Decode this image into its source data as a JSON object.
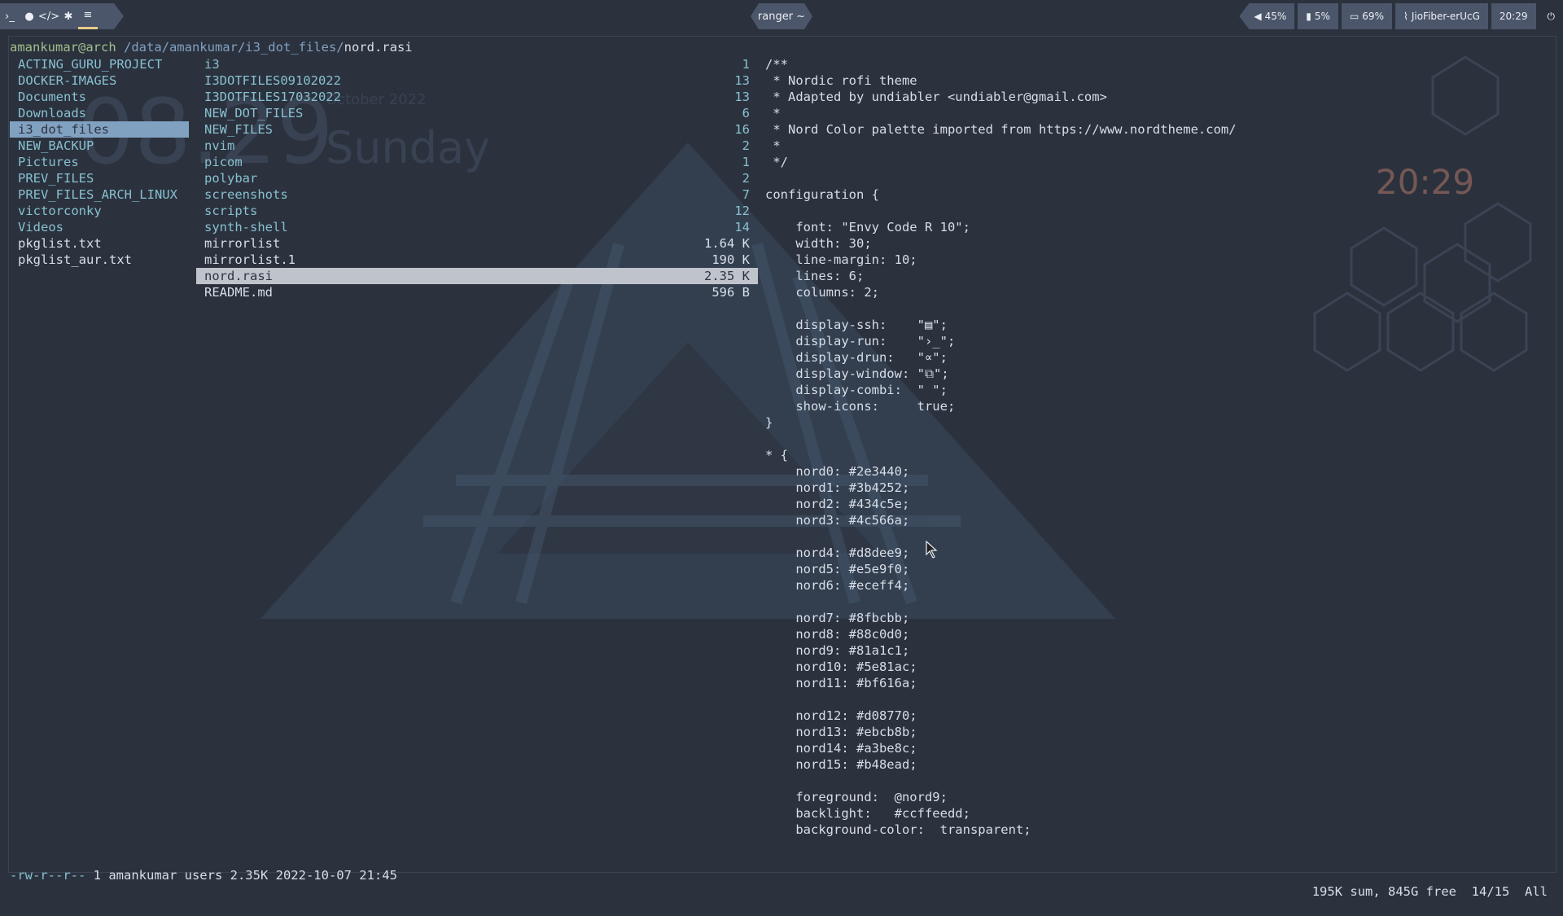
{
  "topbar": {
    "workspaces": [
      {
        "icon": "terminal-icon",
        "glyph": "›_"
      },
      {
        "icon": "firefox-icon",
        "glyph": "●"
      },
      {
        "icon": "code-icon",
        "glyph": "</>"
      },
      {
        "icon": "gear-icon",
        "glyph": "✱"
      },
      {
        "icon": "menu-icon",
        "glyph": "≡"
      }
    ],
    "window_title": "ranger ~",
    "volume": "45%",
    "brightness": "5%",
    "battery": "69%",
    "wifi": "JioFiber-erUcG",
    "time": "20:29"
  },
  "ranger": {
    "user_host": "amankumar@arch",
    "path_dir": " /data/amankumar/i3_dot_files/",
    "path_file": "nord.rasi",
    "parent_column": [
      {
        "name": "ACTING_GURU_PROJECT",
        "type": "dir"
      },
      {
        "name": "DOCKER-IMAGES",
        "type": "dir"
      },
      {
        "name": "Documents",
        "type": "dir"
      },
      {
        "name": "Downloads",
        "type": "dir"
      },
      {
        "name": "i3_dot_files",
        "type": "dir",
        "selected": true
      },
      {
        "name": "NEW_BACKUP",
        "type": "dir"
      },
      {
        "name": "Pictures",
        "type": "dir"
      },
      {
        "name": "PREV_FILES",
        "type": "dir"
      },
      {
        "name": "PREV_FILES_ARCH_LINUX",
        "type": "dir"
      },
      {
        "name": "victorconky",
        "type": "dir"
      },
      {
        "name": "Videos",
        "type": "dir"
      },
      {
        "name": "pkglist.txt",
        "type": "file"
      },
      {
        "name": "pkglist_aur.txt",
        "type": "file"
      }
    ],
    "current_column": [
      {
        "name": "i3",
        "size": "1",
        "type": "dir"
      },
      {
        "name": "I3DOTFILES09102022",
        "size": "13",
        "type": "dir"
      },
      {
        "name": "I3DOTFILES17032022",
        "size": "13",
        "type": "dir"
      },
      {
        "name": "NEW_DOT_FILES",
        "size": "6",
        "type": "dir"
      },
      {
        "name": "NEW_FILES",
        "size": "16",
        "type": "dir"
      },
      {
        "name": "nvim",
        "size": "2",
        "type": "dir"
      },
      {
        "name": "picom",
        "size": "1",
        "type": "dir"
      },
      {
        "name": "polybar",
        "size": "2",
        "type": "dir"
      },
      {
        "name": "screenshots",
        "size": "7",
        "type": "dir"
      },
      {
        "name": "scripts",
        "size": "12",
        "type": "dir"
      },
      {
        "name": "synth-shell",
        "size": "14",
        "type": "dir"
      },
      {
        "name": "mirrorlist",
        "size": "1.64 K",
        "type": "file"
      },
      {
        "name": "mirrorlist.1",
        "size": "190 K",
        "type": "file"
      },
      {
        "name": "nord.rasi",
        "size": "2.35 K",
        "type": "file",
        "selected": true
      },
      {
        "name": "README.md",
        "size": "596 B",
        "type": "file"
      }
    ],
    "preview_lines": [
      "/**",
      " * Nordic rofi theme",
      " * Adapted by undiabler <undiabler@gmail.com>",
      " *",
      " * Nord Color palette imported from https://www.nordtheme.com/",
      " *",
      " */",
      "",
      "configuration {",
      "",
      "    font: \"Envy Code R 10\";",
      "    width: 30;",
      "    line-margin: 10;",
      "    lines: 6;",
      "    columns: 2;",
      "",
      "    display-ssh:    \"▤\";",
      "    display-run:    \"›_\";",
      "    display-drun:   \"∝\";",
      "    display-window: \"⧉\";",
      "    display-combi:  \" \";",
      "    show-icons:     true;",
      "}",
      "",
      "* {",
      "    nord0: #2e3440;",
      "    nord1: #3b4252;",
      "    nord2: #434c5e;",
      "    nord3: #4c566a;",
      "",
      "    nord4: #d8dee9;",
      "    nord5: #e5e9f0;",
      "    nord6: #eceff4;",
      "",
      "    nord7: #8fbcbb;",
      "    nord8: #88c0d0;",
      "    nord9: #81a1c1;",
      "    nord10: #5e81ac;",
      "    nord11: #bf616a;",
      "",
      "    nord12: #d08770;",
      "    nord13: #ebcb8b;",
      "    nord14: #a3be8c;",
      "    nord15: #b48ead;",
      "",
      "    foreground:  @nord9;",
      "    backlight:   #ccffeedd;",
      "    background-color:  transparent;"
    ],
    "status": {
      "permissions": "-rw-r--r--",
      "info": " 1 amankumar users 2.35K 2022-10-07 21:45",
      "summary": "195K sum, 845G free  14/15  All"
    }
  },
  "desktop_widget": {
    "clock": "08.29",
    "day": "Sunday",
    "date": "October 2022",
    "conky_time": "20:29"
  },
  "colors": {
    "background": "#2b323e",
    "accent": "#81a1c1",
    "directory": "#88c0d0",
    "user": "#a3be8c",
    "highlight": "#ebcb8b"
  }
}
